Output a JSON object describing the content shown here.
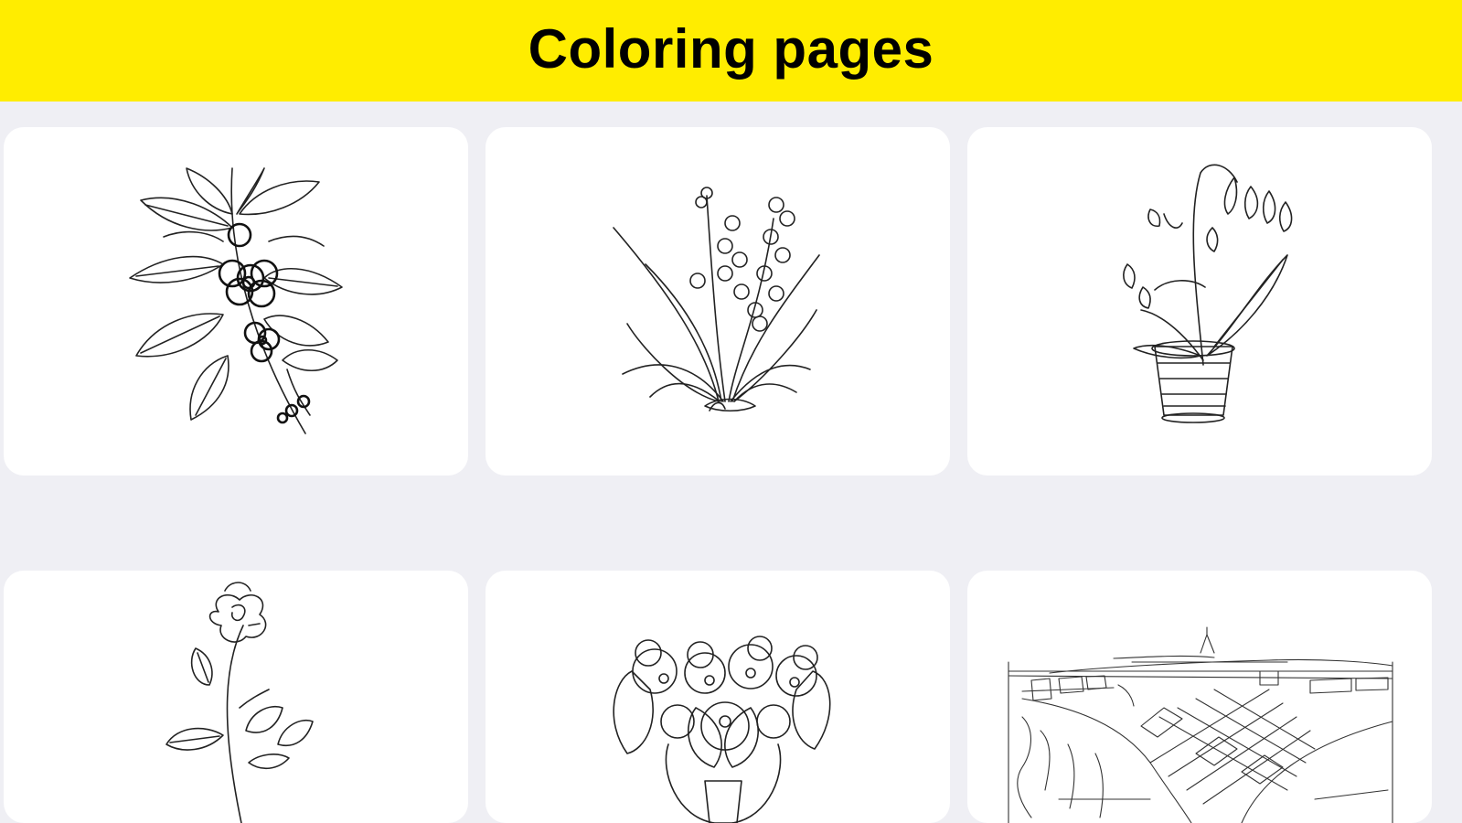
{
  "header": {
    "title": "Coloring pages"
  },
  "colors": {
    "header_background": "#ffed00",
    "page_background": "#efeff4",
    "card_background": "#ffffff",
    "line_art": "#222222"
  },
  "pages": [
    {
      "icon": "leafy-flower-branch-drawing"
    },
    {
      "icon": "wildflower-bunch-drawing"
    },
    {
      "icon": "bell-flower-in-pot-drawing"
    },
    {
      "icon": "rose-stem-drawing"
    },
    {
      "icon": "violet-flowers-drawing"
    },
    {
      "icon": "city-river-landscape-drawing"
    }
  ]
}
